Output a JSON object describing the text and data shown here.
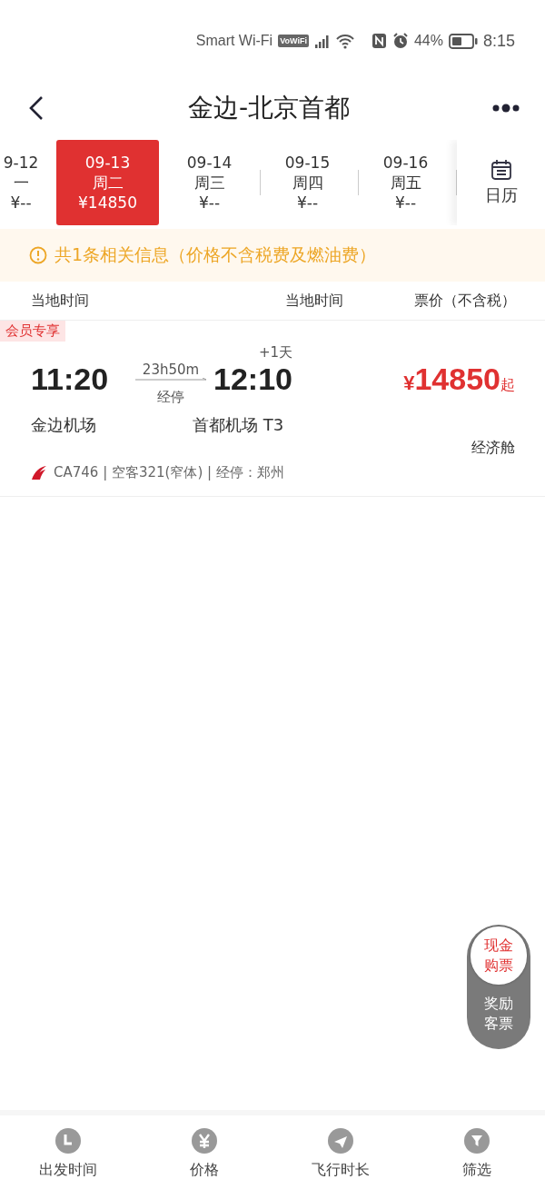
{
  "status_bar": {
    "network_label": "Smart Wi-Fi",
    "vowifi_badge": "VoWiFi",
    "battery_percent": "44%",
    "time": "8:15"
  },
  "nav": {
    "title": "金边-北京首都"
  },
  "dates": [
    {
      "date": "9-12",
      "weekday": "一",
      "price": "¥--",
      "selected": false
    },
    {
      "date": "09-13",
      "weekday": "周二",
      "price": "¥14850",
      "selected": true
    },
    {
      "date": "09-14",
      "weekday": "周三",
      "price": "¥--",
      "selected": false
    },
    {
      "date": "09-15",
      "weekday": "周四",
      "price": "¥--",
      "selected": false
    },
    {
      "date": "09-16",
      "weekday": "周五",
      "price": "¥--",
      "selected": false
    }
  ],
  "calendar_button": {
    "label": "日历"
  },
  "notice": {
    "text": "共1条相关信息（价格不含税费及燃油费）"
  },
  "columns": [
    "当地时间",
    "当地时间",
    "票价（不含税）"
  ],
  "flights": [
    {
      "tag": "会员专享",
      "depart_time": "11:20",
      "depart_airport": "金边机场",
      "duration": "23h50m",
      "stop_label": "经停",
      "day_offset": "+1天",
      "arrive_time": "12:10",
      "arrive_airport": "首都机场 T3",
      "currency": "¥",
      "price": "14850",
      "price_suffix": "起",
      "cabin": "经济舱",
      "details": "CA746 | 空客321(窄体) | 经停：郑州"
    }
  ],
  "float_button": {
    "top": "现金购票",
    "bottom": "奖励客票"
  },
  "bottom_tabs": [
    {
      "kind": "clock",
      "label": "出发时间"
    },
    {
      "kind": "yen",
      "label": "价格"
    },
    {
      "kind": "duration",
      "label": "飞行时长"
    },
    {
      "kind": "filter",
      "label": "筛选"
    }
  ]
}
